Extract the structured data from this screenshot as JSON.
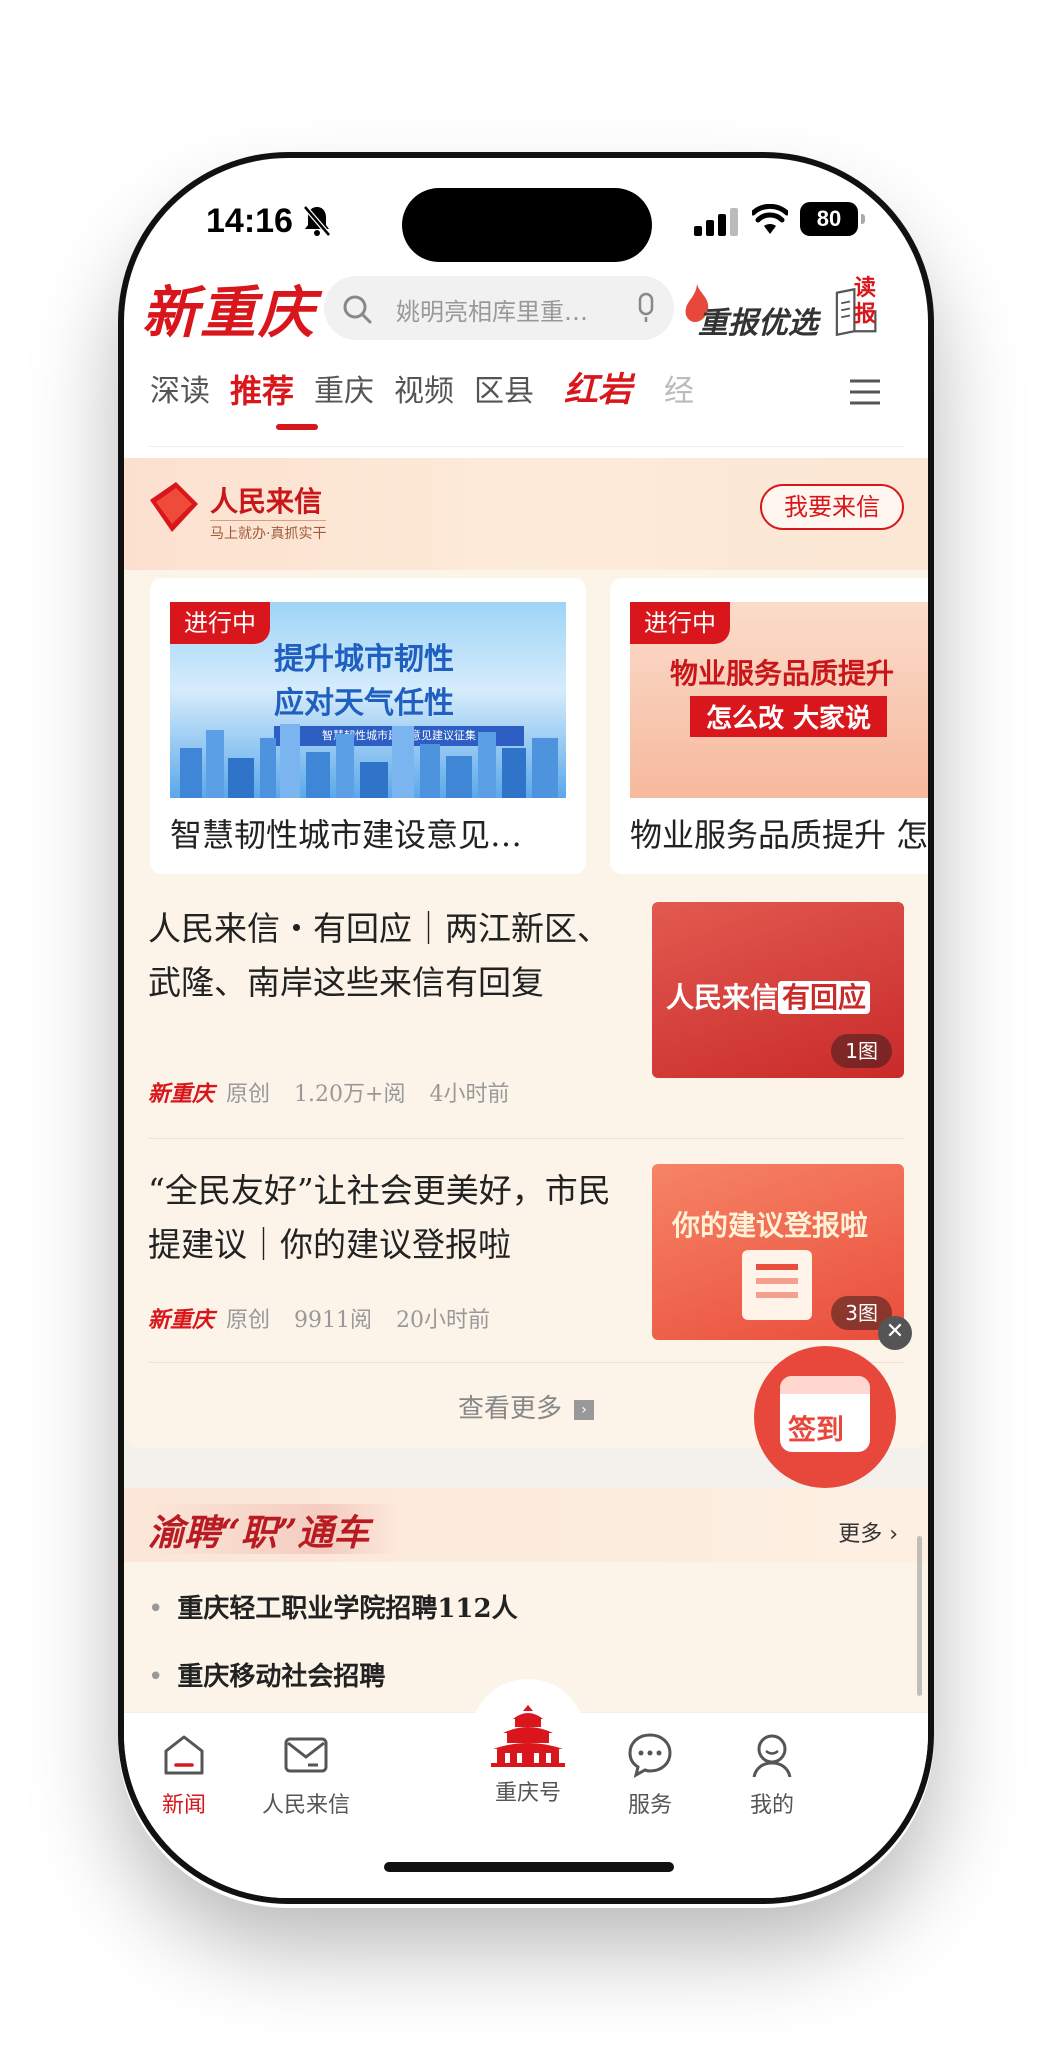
{
  "status": {
    "time": "14:16",
    "battery": "80"
  },
  "header": {
    "logo": "新重庆",
    "search_placeholder": "姚明亮相库里重…",
    "chongbao": "重报优选",
    "dubao": "读报"
  },
  "tabs": [
    "深读",
    "推荐",
    "重庆",
    "视频",
    "区县",
    "红岩",
    "经"
  ],
  "letters": {
    "name": "人民来信",
    "slogan": "马上就办·真抓实干",
    "write_button": "我要来信",
    "cards": [
      {
        "badge": "进行中",
        "img_title1": "提升城市韧性",
        "img_title2": "应对天气任性",
        "img_banner": "智慧韧性城市建设意见建议征集",
        "caption": "智慧韧性城市建设意见…"
      },
      {
        "badge": "进行中",
        "img_title1": "物业服务品质提升",
        "img_title2": "怎么改 大家说",
        "caption": "物业服务品质提升 怎"
      }
    ],
    "articles": [
      {
        "title": "人民来信・有回应｜两江新区、武隆、南岸这些来信有回复",
        "source": "新重庆",
        "type": "原创",
        "reads": "1.20万+阅",
        "time": "4小时前",
        "thumb_head": "人民来信",
        "thumb_tag": "有回应",
        "count": "1图"
      },
      {
        "title": "“全民友好”让社会更美好，市民提建议｜你的建议登报啦",
        "source": "新重庆",
        "type": "原创",
        "reads": "9911阅",
        "time": "20小时前",
        "thumb_head": "你的建议登报啦",
        "count": "3图"
      }
    ],
    "more": "查看更多"
  },
  "jobs": {
    "title": "渝聘“职”通车",
    "more": "更多",
    "items": [
      "重庆轻工职业学院招聘112人",
      "重庆移动社会招聘"
    ]
  },
  "checkin": {
    "label": "签到"
  },
  "bottom_nav": [
    {
      "label": "新闻",
      "icon": "home-icon"
    },
    {
      "label": "人民来信",
      "icon": "mail-icon"
    },
    {
      "label": "重庆号",
      "icon": "hall-icon"
    },
    {
      "label": "服务",
      "icon": "chat-icon"
    },
    {
      "label": "我的",
      "icon": "user-icon"
    }
  ],
  "colors": {
    "accent": "#d8161b",
    "card_bg": "#fcf4e8"
  }
}
